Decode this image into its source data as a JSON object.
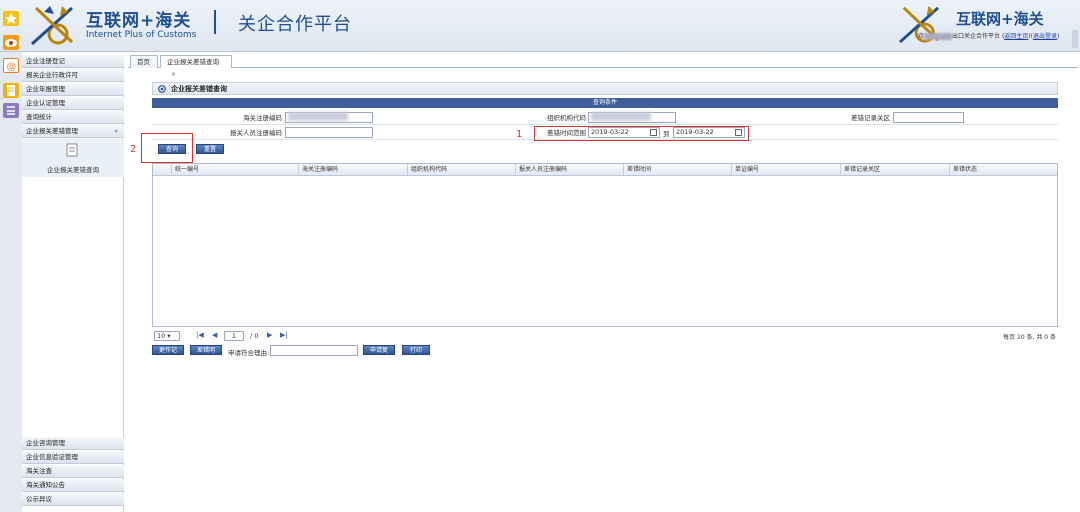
{
  "header": {
    "logo_cn": "互联网+海关",
    "logo_en": "Internet Plus of Customs",
    "platform": "关企合作平台",
    "logo_cn_right": "互联网+海关",
    "welcome_prefix": "欢",
    "welcome_suffix": "出口关企合作平台",
    "link_home": "返回主页",
    "link_logout": "退出登录"
  },
  "sidebar": {
    "items": [
      {
        "label": "企业注册登记"
      },
      {
        "label": "报关企业行政许可"
      },
      {
        "label": "企业年报管理"
      },
      {
        "label": "企业认证管理"
      },
      {
        "label": "查询统计"
      },
      {
        "label": "企业报关差错管理",
        "expanded_mark": "«"
      }
    ],
    "submenu_label": "企业报关差错查询",
    "bottom_items": [
      {
        "label": "企业咨询管理"
      },
      {
        "label": "企业信息验证管理"
      },
      {
        "label": "海关注查"
      },
      {
        "label": "海关通知公告"
      },
      {
        "label": "公示异议"
      }
    ]
  },
  "tabs": [
    {
      "label": "首页"
    },
    {
      "label": "企业报关差错查询",
      "close": "×"
    }
  ],
  "panel": {
    "title": "企业报关差错查询",
    "conditions_header": "查询条件"
  },
  "form": {
    "customs_reg_label": "海关注册编码",
    "org_code_label": "组织机构代码",
    "error_record_customs_label": "差错记录关区",
    "declarer_reg_label": "报关人员注册编码",
    "error_time_label": "差错时间范围",
    "date_from": "2019-03-22",
    "to_label": "到",
    "date_to": "2019-03-22"
  },
  "buttons": {
    "query": "查询",
    "reset": "重置",
    "modify_record": "更作记录",
    "error_detail": "差错明细",
    "apply_review": "申请复核",
    "print": "打印"
  },
  "annotations": {
    "one": "1",
    "two": "2"
  },
  "grid": {
    "columns": [
      "统一编号",
      "海关注册编码",
      "组织机构代码",
      "报关人员注册编码",
      "差错时间",
      "单证编号",
      "差错记录关区",
      "差错状态"
    ]
  },
  "pager": {
    "page_size": "10",
    "first": "|◀",
    "prev": "◀",
    "current": "1",
    "total": "/ 0",
    "next": "▶",
    "last": "▶|",
    "summary": "每页 10 条, 共 0 条"
  },
  "reason_label": "申请符合理由:"
}
